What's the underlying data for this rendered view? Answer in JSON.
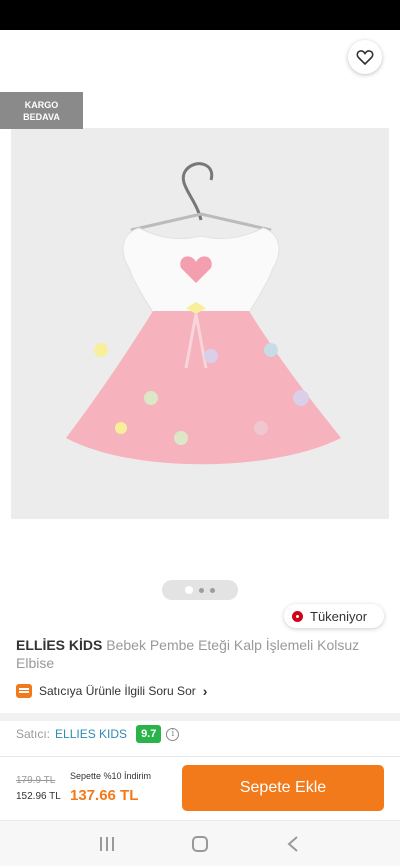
{
  "badges": {
    "cargo_line1": "KARGO",
    "cargo_line2": "BEDAVA",
    "stock_status": "Tükeniyor"
  },
  "product": {
    "brand": "ELLİES KİDS",
    "name": "Bebek Pembe Eteği Kalp İşlemeli  Kolsuz Elbise",
    "image_description": "pink baby dress with white top, heart embroidery, hanger",
    "gallery_total": 3,
    "gallery_active": 1
  },
  "ask_seller": {
    "label": "Satıcıya Ürünle İlgili Soru Sor",
    "chevron": "›"
  },
  "seller": {
    "label": "Satıcı:",
    "name": "ELLIES KIDS",
    "score": "9.7",
    "info": "i"
  },
  "price": {
    "old": "179.9 TL",
    "base": "152.96 TL",
    "cart_discount_label": "Sepette %10 İndirim",
    "cart_price": "137.66 TL"
  },
  "actions": {
    "add_to_cart": "Sepete Ekle"
  },
  "icons": {
    "back": "back-arrow-icon",
    "share": "share-icon",
    "favorite": "heart-icon",
    "recents": "recents-icon",
    "home": "home-icon",
    "nav_back": "nav-back-icon"
  },
  "colors": {
    "accent": "#f27a1a",
    "seller_link": "#2f8bb3",
    "score": "#2bb34b",
    "stock": "#d0021b"
  }
}
